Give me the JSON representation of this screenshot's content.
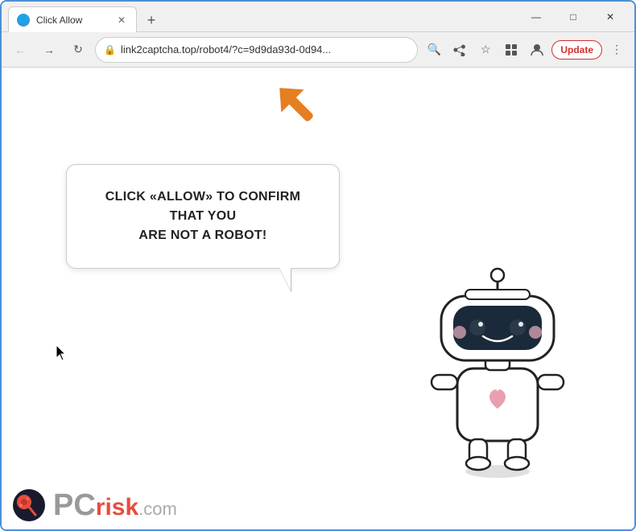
{
  "browser": {
    "tab_title": "Click Allow",
    "tab_favicon": "🌐",
    "address": "link2captcha.top/robot4/?c=9d9da93d-0d94...",
    "new_tab_label": "+",
    "nav": {
      "back": "←",
      "forward": "→",
      "refresh": "↺"
    },
    "window_controls": {
      "minimize": "—",
      "maximize": "□",
      "close": "✕"
    },
    "toolbar_icons": {
      "search": "🔍",
      "share": "↗",
      "bookmark": "☆",
      "extensions": "⊡",
      "profile": "👤"
    },
    "update_button": "Update"
  },
  "page": {
    "bubble_line1": "CLICK «ALLOW» TO CONFIRM THAT YOU",
    "bubble_line2": "ARE NOT A ROBOT!"
  },
  "watermark": {
    "pc": "PC",
    "risk": "risk",
    "com": ".com"
  }
}
